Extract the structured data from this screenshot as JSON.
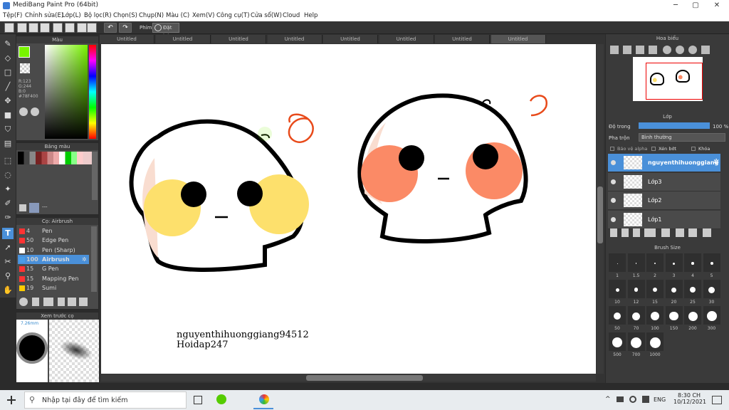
{
  "window": {
    "title": "MediBang Paint Pro (64bit)",
    "min": "─",
    "max": "▢",
    "close": "✕"
  },
  "menu": [
    "Tệp(F)",
    "Chỉnh sửa(E)",
    "Lớp(L)",
    "Bộ lọc(R)",
    "Chọn(S)",
    "Chụp(N)",
    "Màu (C)",
    "Xem(V)",
    "Công cụ(T)",
    "Cửa sổ(W)",
    "Cloud",
    "Help"
  ],
  "toolbar": {
    "phim_label": "Phím",
    "reset_label": "Đặt lại"
  },
  "color_panel": {
    "title": "Màu",
    "primary_color": "#78F400",
    "rgb_r": "R:123",
    "rgb_g": "G:244",
    "rgb_b": "B:0",
    "hex": "#78F400"
  },
  "palette_panel": {
    "title": "Bảng màu",
    "value": "---"
  },
  "brush_panel": {
    "title": "Cọ: Airbrush",
    "items": [
      {
        "size": "4",
        "name": "Pen",
        "color": "#ff3333"
      },
      {
        "size": "50",
        "name": "Edge Pen",
        "color": "#ff3333"
      },
      {
        "size": "10",
        "name": "Pen (Sharp)",
        "color": "#ffffff"
      },
      {
        "size": "100",
        "name": "Airbrush",
        "color": "#4a9de8"
      },
      {
        "size": "15",
        "name": "G Pen",
        "color": "#ff3333"
      },
      {
        "size": "15",
        "name": "Mapping Pen",
        "color": "#ff3333"
      },
      {
        "size": "19",
        "name": "Sumi",
        "color": "#ffcc00"
      }
    ]
  },
  "preview_panel": {
    "title": "Xem trước cọ",
    "size": "7.26mm"
  },
  "tabs": [
    "Untitled",
    "Untitled",
    "Untitled",
    "Untitled",
    "Untitled",
    "Untitled",
    "Untitled",
    "Untitled"
  ],
  "canvas_text": {
    "line1": "nguyenthihuonggiang94512",
    "line2": "Hoidap247"
  },
  "navigator": {
    "title": "Hoa biểu"
  },
  "layer_panel": {
    "title": "Lớp",
    "opacity_label": "Độ trong",
    "opacity_value": "100 %",
    "blend_label": "Pha trộn",
    "blend_value": "Bình thường",
    "protect_alpha": "Bảo vệ alpha",
    "clip": "Xén bớt",
    "lock": "Khóa",
    "layers": [
      "nguyenthihuonggiang",
      "Lớp3",
      "Lớp2",
      "Lớp1"
    ]
  },
  "brush_size": {
    "title": "Brush Size",
    "sizes": [
      "1",
      "1.5",
      "2",
      "3",
      "4",
      "5",
      "10",
      "12",
      "15",
      "20",
      "25",
      "30",
      "50",
      "70",
      "100",
      "150",
      "200",
      "300",
      "500",
      "700",
      "1000"
    ]
  },
  "taskbar": {
    "search_placeholder": "Nhập tại đây để tìm kiếm",
    "lang": "ENG",
    "time": "8:30 CH",
    "date": "10/12/2021"
  }
}
